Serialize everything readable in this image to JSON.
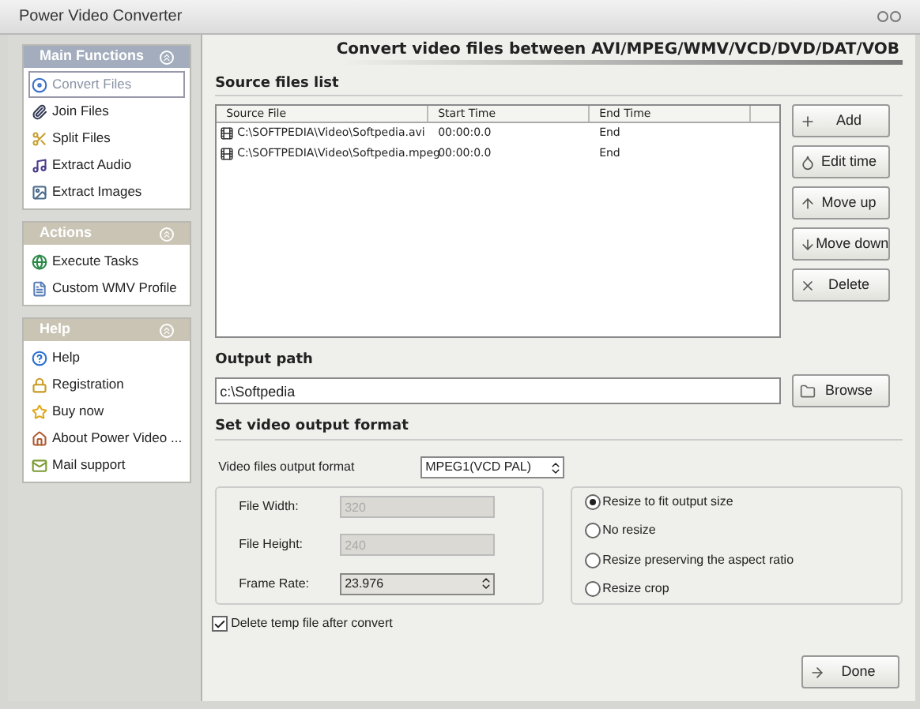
{
  "window": {
    "title": "Power Video Converter"
  },
  "sidebar": {
    "panels": [
      {
        "title": "Main Functions",
        "color": "#a3adbd",
        "items": [
          {
            "label": "Convert Files",
            "kind": "convert",
            "selected": true
          },
          {
            "label": "Join Files",
            "kind": "join",
            "selected": false
          },
          {
            "label": "Split Files",
            "kind": "split",
            "selected": false
          },
          {
            "label": "Extract Audio",
            "kind": "audio",
            "selected": false
          },
          {
            "label": "Extract Images",
            "kind": "images",
            "selected": false
          }
        ]
      },
      {
        "title": "Actions",
        "color": "#c9c4b4",
        "items": [
          {
            "label": "Execute Tasks",
            "kind": "execute",
            "selected": false
          },
          {
            "label": "Custom WMV Profile",
            "kind": "profile",
            "selected": false
          }
        ]
      },
      {
        "title": "Help",
        "color": "#c9c4b4",
        "items": [
          {
            "label": "Help",
            "kind": "help",
            "selected": false
          },
          {
            "label": "Registration",
            "kind": "registration",
            "selected": false
          },
          {
            "label": "Buy now",
            "kind": "buy",
            "selected": false
          },
          {
            "label": "About Power Video ...",
            "kind": "about",
            "selected": false
          },
          {
            "label": "Mail support",
            "kind": "mail",
            "selected": false
          }
        ]
      }
    ]
  },
  "header": "Convert video files between AVI/MPEG/WMV/VCD/DVD/DAT/VOB",
  "source_list": {
    "title": "Source files list",
    "columns": [
      "Source File",
      "Start Time",
      "End Time"
    ],
    "rows": [
      {
        "cells": [
          "C:\\SOFTPEDIA\\Video\\Softpedia.avi",
          "00:00:0.0",
          "End"
        ]
      },
      {
        "cells": [
          "C:\\SOFTPEDIA\\Video\\Softpedia.mpeg",
          "00:00:0.0",
          "End"
        ]
      }
    ]
  },
  "list_buttons": [
    {
      "label": "Add",
      "kind": "add"
    },
    {
      "label": "Edit time",
      "kind": "edit"
    },
    {
      "label": "Move up",
      "kind": "up"
    },
    {
      "label": "Move down",
      "kind": "down"
    },
    {
      "label": "Delete",
      "kind": "delete"
    }
  ],
  "output_path": {
    "title": "Output path",
    "value": "c:\\Softpedia",
    "button": "Browse"
  },
  "format": {
    "title": "Set video output format",
    "format_label": "Video files output format",
    "format_value": "MPEG1(VCD PAL)",
    "fields": [
      {
        "label": "File Width:",
        "value": "320",
        "kind": "text",
        "disabled": true
      },
      {
        "label": "File Height:",
        "value": "240",
        "kind": "text",
        "disabled": true
      },
      {
        "label": "Frame Rate:",
        "value": "23.976",
        "kind": "select",
        "disabled": false
      }
    ],
    "resize_options": [
      {
        "label": "Resize to fit output size",
        "selected": true
      },
      {
        "label": "No resize",
        "selected": false
      },
      {
        "label": "Resize preserving the aspect ratio",
        "selected": false
      },
      {
        "label": "Resize crop",
        "selected": false
      }
    ],
    "delete_temp": {
      "label": "Delete temp file after convert",
      "checked": true
    }
  },
  "done_button": "Done"
}
